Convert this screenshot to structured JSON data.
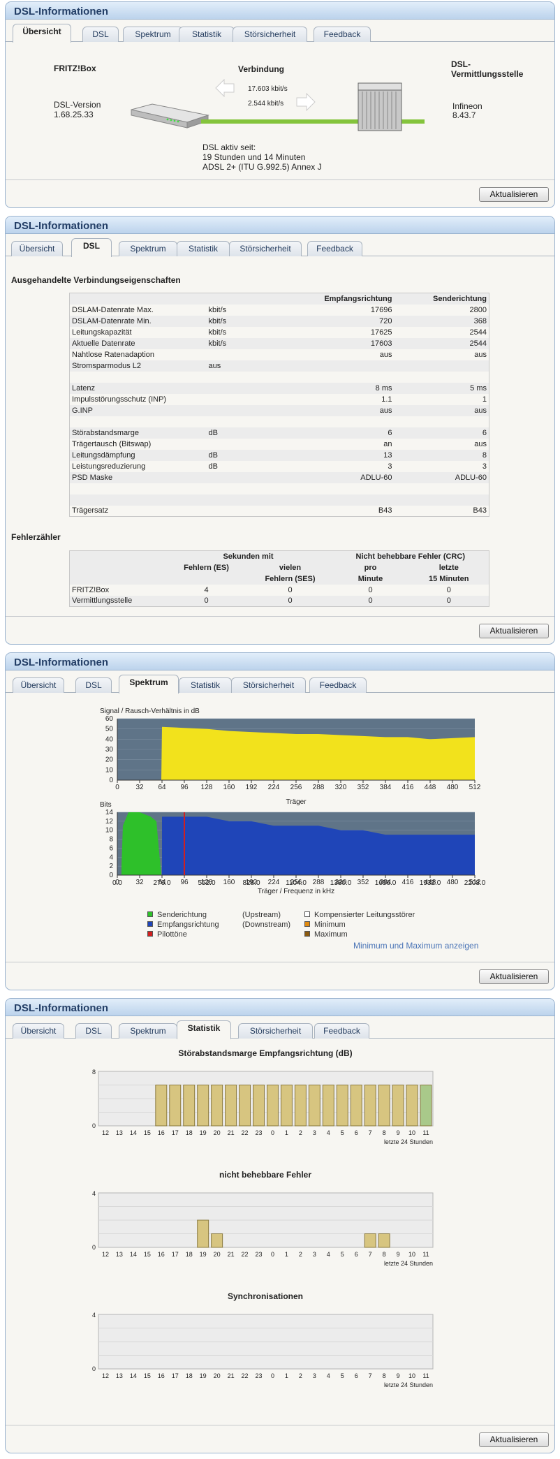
{
  "panel_title": "DSL-Informationen",
  "tabs": [
    "Übersicht",
    "DSL",
    "Spektrum",
    "Statistik",
    "Störsicherheit",
    "Feedback"
  ],
  "refresh_label": "Aktualisieren",
  "overview": {
    "fritzbox_label": "FRITZ!Box",
    "dsl_version_label": "DSL-Version",
    "dsl_version": "1.68.25.33",
    "connection_label": "Verbindung",
    "downstream_rate": "17.603 kbit/s",
    "upstream_rate": "2.544 kbit/s",
    "exchange_label_1": "DSL-",
    "exchange_label_2": "Vermittlungsstelle",
    "exchange_vendor": "Infineon",
    "exchange_version": "8.43.7",
    "active_since_label": "DSL aktiv seit:",
    "active_since": "19 Stunden und 14 Minuten",
    "mode": "ADSL 2+ (ITU G.992.5) Annex J"
  },
  "dsl": {
    "section_title": "Ausgehandelte Verbindungseigenschaften",
    "col_rx": "Empfangsrichtung",
    "col_tx": "Senderichtung",
    "rows": [
      {
        "label": "DSLAM-Datenrate Max.",
        "unit": "kbit/s",
        "rx": "17696",
        "tx": "2800"
      },
      {
        "label": "DSLAM-Datenrate Min.",
        "unit": "kbit/s",
        "rx": "720",
        "tx": "368"
      },
      {
        "label": "Leitungskapazität",
        "unit": "kbit/s",
        "rx": "17625",
        "tx": "2544"
      },
      {
        "label": "Aktuelle Datenrate",
        "unit": "kbit/s",
        "rx": "17603",
        "tx": "2544"
      },
      {
        "label": "Nahtlose Ratenadaption",
        "unit": "",
        "rx": "aus",
        "tx": "aus"
      },
      {
        "label": "Stromsparmodus L2",
        "unit": "aus",
        "rx": "",
        "tx": ""
      },
      {
        "label": "",
        "unit": "",
        "rx": "",
        "tx": ""
      },
      {
        "label": "Latenz",
        "unit": "",
        "rx": "8 ms",
        "tx": "5 ms"
      },
      {
        "label": "Impulsstörungsschutz (INP)",
        "unit": "",
        "rx": "1.1",
        "tx": "1"
      },
      {
        "label": "G.INP",
        "unit": "",
        "rx": "aus",
        "tx": "aus"
      },
      {
        "label": "",
        "unit": "",
        "rx": "",
        "tx": ""
      },
      {
        "label": "Störabstandsmarge",
        "unit": "dB",
        "rx": "6",
        "tx": "6"
      },
      {
        "label": "Trägertausch (Bitswap)",
        "unit": "",
        "rx": "an",
        "tx": "aus"
      },
      {
        "label": "Leitungsdämpfung",
        "unit": "dB",
        "rx": "13",
        "tx": "8"
      },
      {
        "label": "Leistungsreduzierung",
        "unit": "dB",
        "rx": "3",
        "tx": "3"
      },
      {
        "label": "PSD Maske",
        "unit": "",
        "rx": "ADLU-60",
        "tx": "ADLU-60"
      },
      {
        "label": "",
        "unit": "",
        "rx": "",
        "tx": ""
      },
      {
        "label": "",
        "unit": "",
        "rx": "",
        "tx": ""
      },
      {
        "label": "Trägersatz",
        "unit": "",
        "rx": "B43",
        "tx": "B43"
      }
    ],
    "error_title": "Fehlerzähler",
    "err_hdr_seconds": "Sekunden mit",
    "err_hdr_crc": "Nicht behebbare Fehler (CRC)",
    "err_sub": [
      "Fehlern (ES)",
      "vielen",
      "pro",
      "letzte"
    ],
    "err_sub2": [
      "",
      "Fehlern (SES)",
      "Minute",
      "15 Minuten"
    ],
    "err_rows": [
      {
        "label": "FRITZ!Box",
        "values": [
          "4",
          "0",
          "0",
          "0"
        ]
      },
      {
        "label": "Vermittlungsstelle",
        "values": [
          "0",
          "0",
          "0",
          "0"
        ]
      }
    ]
  },
  "spectrum": {
    "snr_title": "Signal / Rausch-Verhältnis in dB",
    "snr_yticks": [
      "60",
      "50",
      "40",
      "30",
      "20",
      "10",
      "0"
    ],
    "x_ticks": [
      "0",
      "32",
      "64",
      "96",
      "128",
      "160",
      "192",
      "224",
      "256",
      "288",
      "320",
      "352",
      "384",
      "416",
      "448",
      "480",
      "512"
    ],
    "snr_xlabel": "Träger",
    "bits_title": "Bits",
    "bits_yticks": [
      "14",
      "12",
      "10",
      "8",
      "6",
      "4",
      "2",
      "0"
    ],
    "freq_ticks": [
      "0.0",
      "276.0",
      "552.0",
      "828.0",
      "1104.0",
      "1380.0",
      "1656.0",
      "1932.0",
      "2208.0"
    ],
    "bits_xlabel": "Träger / Frequenz in kHz",
    "legend": {
      "up": "Senderichtung",
      "up2": "(Upstream)",
      "down": "Empfangsrichtung",
      "down2": "(Downstream)",
      "pilot": "Pilottöne",
      "comp": "Kompensierter Leitungsstörer",
      "min": "Minimum",
      "max": "Maximum"
    },
    "minmax_link": "Minimum und Maximum anzeigen",
    "colors": {
      "snr": "#f2e21c",
      "up": "#2ec02a",
      "down": "#1f45b8",
      "pilot": "#d02020",
      "bg": "#5f7488"
    }
  },
  "chart_data": [
    {
      "type": "area",
      "title": "Signal / Rausch-Verhältnis in dB",
      "xlabel": "Träger",
      "ylim": [
        0,
        60
      ],
      "xlim": [
        0,
        512
      ],
      "series": [
        {
          "name": "Empfangsrichtung",
          "x": [
            0,
            63,
            64,
            96,
            128,
            160,
            192,
            224,
            256,
            288,
            320,
            352,
            384,
            416,
            448,
            480,
            512
          ],
          "values": [
            0,
            0,
            52,
            51,
            50,
            48,
            47,
            46,
            45,
            45,
            44,
            43,
            42,
            42,
            40,
            41,
            42
          ]
        }
      ]
    },
    {
      "type": "area",
      "title": "Bits",
      "xlabel": "Träger / Frequenz in kHz",
      "ylim": [
        0,
        14
      ],
      "xlim": [
        0,
        512
      ],
      "series": [
        {
          "name": "Senderichtung",
          "x": [
            6,
            8,
            16,
            32,
            48,
            56,
            60,
            63
          ],
          "values": [
            2,
            11,
            14,
            14,
            13,
            12,
            5,
            0
          ]
        },
        {
          "name": "Empfangsrichtung",
          "x": [
            64,
            96,
            128,
            160,
            192,
            224,
            256,
            288,
            320,
            352,
            384,
            416,
            448,
            480,
            512
          ],
          "values": [
            13,
            13,
            13,
            12,
            12,
            11,
            11,
            11,
            10,
            10,
            9,
            9,
            9,
            9,
            9
          ]
        }
      ]
    },
    {
      "type": "bar",
      "title": "Störabstandsmarge Empfangsrichtung (dB)",
      "categories": [
        "12",
        "13",
        "14",
        "15",
        "16",
        "17",
        "18",
        "19",
        "20",
        "21",
        "22",
        "23",
        "0",
        "1",
        "2",
        "3",
        "4",
        "5",
        "6",
        "7",
        "8",
        "9",
        "10",
        "11"
      ],
      "values": [
        0,
        0,
        0,
        0,
        6,
        6,
        6,
        6,
        6,
        6,
        6,
        6,
        6,
        6,
        6,
        6,
        6,
        6,
        6,
        6,
        6,
        6,
        6,
        6
      ],
      "ylim": [
        0,
        8
      ],
      "xlabel": "letzte 24 Stunden"
    },
    {
      "type": "bar",
      "title": "nicht behebbare Fehler",
      "categories": [
        "12",
        "13",
        "14",
        "15",
        "16",
        "17",
        "18",
        "19",
        "20",
        "21",
        "22",
        "23",
        "0",
        "1",
        "2",
        "3",
        "4",
        "5",
        "6",
        "7",
        "8",
        "9",
        "10",
        "11"
      ],
      "values": [
        0,
        0,
        0,
        0,
        0,
        0,
        0,
        2,
        1,
        0,
        0,
        0,
        0,
        0,
        0,
        0,
        0,
        0,
        0,
        1,
        1,
        0,
        0,
        0
      ],
      "ylim": [
        0,
        4
      ],
      "xlabel": "letzte 24 Stunden"
    },
    {
      "type": "bar",
      "title": "Synchronisationen",
      "categories": [
        "12",
        "13",
        "14",
        "15",
        "16",
        "17",
        "18",
        "19",
        "20",
        "21",
        "22",
        "23",
        "0",
        "1",
        "2",
        "3",
        "4",
        "5",
        "6",
        "7",
        "8",
        "9",
        "10",
        "11"
      ],
      "values": [
        0,
        0,
        0,
        0,
        0,
        0,
        0,
        0,
        0,
        0,
        0,
        0,
        0,
        0,
        0,
        0,
        0,
        0,
        0,
        0,
        0,
        0,
        0,
        0
      ],
      "ylim": [
        0,
        4
      ],
      "xlabel": "letzte 24 Stunden"
    }
  ],
  "stats": {
    "hours": [
      "12",
      "13",
      "14",
      "15",
      "16",
      "17",
      "18",
      "19",
      "20",
      "21",
      "22",
      "23",
      "0",
      "1",
      "2",
      "3",
      "4",
      "5",
      "6",
      "7",
      "8",
      "9",
      "10",
      "11"
    ],
    "last24": "letzte 24 Stunden",
    "charts": [
      {
        "title": "Störabstandsmarge Empfangsrichtung (dB)",
        "ymax": "8",
        "values": [
          0,
          0,
          0,
          0,
          6,
          6,
          6,
          6,
          6,
          6,
          6,
          6,
          6,
          6,
          6,
          6,
          6,
          6,
          6,
          6,
          6,
          6,
          6,
          6
        ],
        "max": 8
      },
      {
        "title": "nicht behebbare Fehler",
        "ymax": "4",
        "values": [
          0,
          0,
          0,
          0,
          0,
          0,
          0,
          2,
          1,
          0,
          0,
          0,
          0,
          0,
          0,
          0,
          0,
          0,
          0,
          1,
          1,
          0,
          0,
          0
        ],
        "max": 4
      },
      {
        "title": "Synchronisationen",
        "ymax": "4",
        "values": [
          0,
          0,
          0,
          0,
          0,
          0,
          0,
          0,
          0,
          0,
          0,
          0,
          0,
          0,
          0,
          0,
          0,
          0,
          0,
          0,
          0,
          0,
          0,
          0
        ],
        "max": 4
      }
    ]
  }
}
